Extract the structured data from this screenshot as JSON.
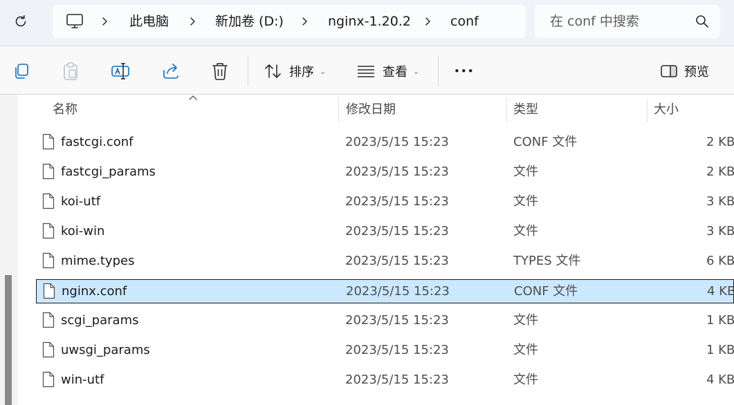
{
  "breadcrumb": {
    "items": [
      "此电脑",
      "新加卷 (D:)",
      "nginx-1.20.2",
      "conf"
    ]
  },
  "search": {
    "placeholder": "在 conf 中搜索"
  },
  "toolbar": {
    "sort_label": "排序",
    "view_label": "查看",
    "more_label": "•••",
    "preview_label": "预览"
  },
  "columns": {
    "name": "名称",
    "date": "修改日期",
    "type": "类型",
    "size": "大小"
  },
  "files": [
    {
      "name": "fastcgi.conf",
      "date": "2023/5/15 15:23",
      "type": "CONF 文件",
      "size": "2 KB"
    },
    {
      "name": "fastcgi_params",
      "date": "2023/5/15 15:23",
      "type": "文件",
      "size": "2 KB"
    },
    {
      "name": "koi-utf",
      "date": "2023/5/15 15:23",
      "type": "文件",
      "size": "3 KB"
    },
    {
      "name": "koi-win",
      "date": "2023/5/15 15:23",
      "type": "文件",
      "size": "3 KB"
    },
    {
      "name": "mime.types",
      "date": "2023/5/15 15:23",
      "type": "TYPES 文件",
      "size": "6 KB"
    },
    {
      "name": "nginx.conf",
      "date": "2023/5/15 15:23",
      "type": "CONF 文件",
      "size": "4 KB"
    },
    {
      "name": "scgi_params",
      "date": "2023/5/15 15:23",
      "type": "文件",
      "size": "1 KB"
    },
    {
      "name": "uwsgi_params",
      "date": "2023/5/15 15:23",
      "type": "文件",
      "size": "1 KB"
    },
    {
      "name": "win-utf",
      "date": "2023/5/15 15:23",
      "type": "文件",
      "size": "4 KB"
    }
  ],
  "selected_file": "nginx.conf",
  "icons": {
    "refresh": "refresh-icon",
    "this_pc": "computer-icon",
    "search": "search-icon",
    "copy": "copy-icon",
    "paste": "paste-icon",
    "rename": "rename-icon",
    "share": "share-icon",
    "delete": "delete-icon",
    "sort": "sort-icon",
    "view": "view-icon",
    "preview": "preview-pane-icon",
    "file": "file-icon"
  },
  "colors": {
    "selection": "#cce8ff",
    "address_bg": "#eff3f9"
  }
}
